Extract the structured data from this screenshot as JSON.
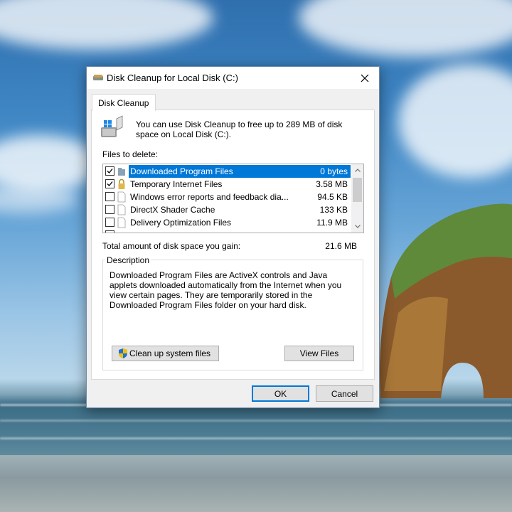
{
  "window": {
    "title": "Disk Cleanup for Local Disk (C:)",
    "icon": "disk-cleanup-icon",
    "close_icon": "close-icon"
  },
  "tabs": [
    {
      "label": "Disk Cleanup",
      "active": true
    }
  ],
  "intro": {
    "icon": "disk-cleanup-large-icon",
    "text": "You can use Disk Cleanup to free up to 289 MB of disk space on Local Disk (C:)."
  },
  "files": {
    "label": "Files to delete:",
    "items": [
      {
        "name": "Downloaded Program Files",
        "size": "0 bytes",
        "checked": true,
        "selected": true,
        "icon": "folder-icon"
      },
      {
        "name": "Temporary Internet Files",
        "size": "3.58 MB",
        "checked": true,
        "selected": false,
        "icon": "lock-icon"
      },
      {
        "name": "Windows error reports and feedback dia...",
        "size": "94.5 KB",
        "checked": false,
        "selected": false,
        "icon": "file-icon"
      },
      {
        "name": "DirectX Shader Cache",
        "size": "133 KB",
        "checked": false,
        "selected": false,
        "icon": "file-icon"
      },
      {
        "name": "Delivery Optimization Files",
        "size": "11.9 MB",
        "checked": false,
        "selected": false,
        "icon": "file-icon"
      }
    ]
  },
  "total": {
    "label": "Total amount of disk space you gain:",
    "value": "21.6 MB"
  },
  "description": {
    "legend": "Description",
    "text": "Downloaded Program Files are ActiveX controls and Java applets downloaded automatically from the Internet when you view certain pages. They are temporarily stored in the Downloaded Program Files folder on your hard disk."
  },
  "buttons": {
    "cleanup_system": "Clean up system files",
    "view_files": "View Files",
    "ok": "OK",
    "cancel": "Cancel"
  },
  "colors": {
    "selection": "#0078d7",
    "window_bg": "#f0f0f0",
    "panel_bg": "#ffffff"
  }
}
